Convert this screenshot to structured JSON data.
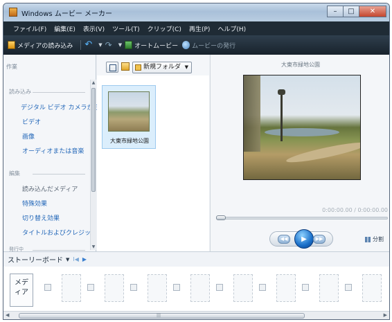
{
  "window": {
    "title": "Windows ムービー メーカー"
  },
  "window_controls": {
    "minimize": "–",
    "maximize": "□",
    "close": "✕"
  },
  "menu": [
    "ファイル(F)",
    "編集(E)",
    "表示(V)",
    "ツール(T)",
    "クリップ(C)",
    "再生(P)",
    "ヘルプ(H)"
  ],
  "toolbar": {
    "import_label": "メディアの読み込み",
    "automovie_label": "オートムービー",
    "publish_label": "ムービーの発行"
  },
  "tasks": {
    "title": "作業",
    "import_heading": "読み込み",
    "import_links": [
      "デジタル ビデオ カメラから",
      "ビデオ",
      "画像",
      "オーディオまたは音楽"
    ],
    "edit_heading": "編集",
    "edit_links": [
      "読み込んだメディア",
      "特殊効果",
      "切り替え効果",
      "タイトルおよびクレジット"
    ],
    "publish_heading": "発行中"
  },
  "collection": {
    "folder_dropdown": "新規フォルダ",
    "clip_label": "大東市緑地公園"
  },
  "preview": {
    "title": "大東市緑地公園",
    "timecode": "0:00:00.00 / 0:00:00.00",
    "split_label": "分割"
  },
  "storyboard": {
    "label": "ストーリーボード",
    "first_slot": "メデ\nィア"
  }
}
